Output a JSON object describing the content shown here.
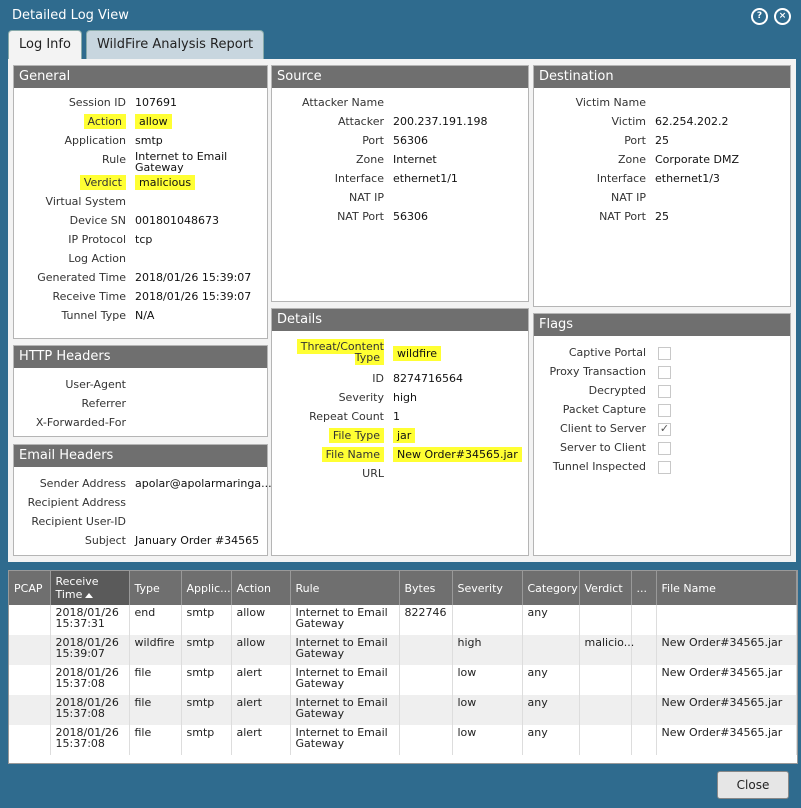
{
  "window": {
    "title": "Detailed Log View"
  },
  "tabs": [
    {
      "label": "Log Info"
    },
    {
      "label": "WildFire Analysis Report"
    }
  ],
  "general": {
    "title": "General",
    "rows": [
      {
        "k": "Session ID",
        "v": "107691"
      },
      {
        "k": "Action",
        "v": "allow"
      },
      {
        "k": "Application",
        "v": "smtp"
      },
      {
        "k": "Rule",
        "v": "Internet to Email Gateway"
      },
      {
        "k": "Verdict",
        "v": "malicious"
      },
      {
        "k": "Virtual System",
        "v": ""
      },
      {
        "k": "Device SN",
        "v": "001801048673"
      },
      {
        "k": "IP Protocol",
        "v": "tcp"
      },
      {
        "k": "Log Action",
        "v": ""
      },
      {
        "k": "Generated Time",
        "v": "2018/01/26 15:39:07"
      },
      {
        "k": "Receive Time",
        "v": "2018/01/26 15:39:07"
      },
      {
        "k": "Tunnel Type",
        "v": "N/A"
      }
    ]
  },
  "http": {
    "title": "HTTP Headers",
    "rows": [
      {
        "k": "User-Agent",
        "v": ""
      },
      {
        "k": "Referrer",
        "v": ""
      },
      {
        "k": "X-Forwarded-For",
        "v": ""
      }
    ]
  },
  "email": {
    "title": "Email Headers",
    "rows": [
      {
        "k": "Sender Address",
        "v": "apolar@apolarmaringa..."
      },
      {
        "k": "Recipient Address",
        "v": ""
      },
      {
        "k": "Recipient User-ID",
        "v": ""
      },
      {
        "k": "Subject",
        "v": "January Order #34565"
      }
    ]
  },
  "source": {
    "title": "Source",
    "rows": [
      {
        "k": "Attacker Name",
        "v": ""
      },
      {
        "k": "Attacker",
        "v": "200.237.191.198"
      },
      {
        "k": "Port",
        "v": "56306"
      },
      {
        "k": "Zone",
        "v": "Internet"
      },
      {
        "k": "Interface",
        "v": "ethernet1/1"
      },
      {
        "k": "NAT IP",
        "v": ""
      },
      {
        "k": "NAT Port",
        "v": "56306"
      }
    ]
  },
  "destination": {
    "title": "Destination",
    "rows": [
      {
        "k": "Victim Name",
        "v": ""
      },
      {
        "k": "Victim",
        "v": "62.254.202.2"
      },
      {
        "k": "Port",
        "v": "25"
      },
      {
        "k": "Zone",
        "v": "Corporate DMZ"
      },
      {
        "k": "Interface",
        "v": "ethernet1/3"
      },
      {
        "k": "NAT IP",
        "v": ""
      },
      {
        "k": "NAT Port",
        "v": "25"
      }
    ]
  },
  "details": {
    "title": "Details",
    "rows": [
      {
        "k": "Threat/Content Type",
        "v": "wildfire"
      },
      {
        "k": "ID",
        "v": "8274716564"
      },
      {
        "k": "Severity",
        "v": "high"
      },
      {
        "k": "Repeat Count",
        "v": "1"
      },
      {
        "k": "File Type",
        "v": "jar"
      },
      {
        "k": "File Name",
        "v": "New Order#34565.jar"
      },
      {
        "k": "URL",
        "v": ""
      }
    ]
  },
  "flags": {
    "title": "Flags",
    "rows": [
      {
        "k": "Captive Portal",
        "checked": false
      },
      {
        "k": "Proxy Transaction",
        "checked": false
      },
      {
        "k": "Decrypted",
        "checked": false
      },
      {
        "k": "Packet Capture",
        "checked": false
      },
      {
        "k": "Client to Server",
        "checked": true
      },
      {
        "k": "Server to Client",
        "checked": false
      },
      {
        "k": "Tunnel Inspected",
        "checked": false
      }
    ]
  },
  "grid": {
    "columns": [
      "PCAP",
      "Receive Time",
      "Type",
      "Applic...",
      "Action",
      "Rule",
      "Bytes",
      "Severity",
      "Category",
      "Verdict",
      "...",
      "File Name"
    ],
    "rows": [
      [
        "",
        "2018/01/26 15:37:31",
        "end",
        "smtp",
        "allow",
        "Internet to Email Gateway",
        "822746",
        "",
        "any",
        "",
        "",
        ""
      ],
      [
        "",
        "2018/01/26 15:39:07",
        "wildfire",
        "smtp",
        "allow",
        "Internet to Email Gateway",
        "",
        "high",
        "",
        "malicio...",
        "",
        "New Order#34565.jar"
      ],
      [
        "",
        "2018/01/26 15:37:08",
        "file",
        "smtp",
        "alert",
        "Internet to Email Gateway",
        "",
        "low",
        "any",
        "",
        "",
        "New Order#34565.jar"
      ],
      [
        "",
        "2018/01/26 15:37:08",
        "file",
        "smtp",
        "alert",
        "Internet to Email Gateway",
        "",
        "low",
        "any",
        "",
        "",
        "New Order#34565.jar"
      ],
      [
        "",
        "2018/01/26 15:37:08",
        "file",
        "smtp",
        "alert",
        "Internet to Email Gateway",
        "",
        "low",
        "any",
        "",
        "",
        "New Order#34565.jar"
      ]
    ]
  },
  "footer": {
    "close_label": "Close"
  }
}
